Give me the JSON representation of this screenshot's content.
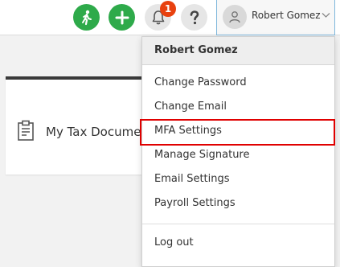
{
  "topbar": {
    "notification_count": "1"
  },
  "user": {
    "name": "Robert Gomez"
  },
  "card": {
    "title": "My Tax Docume"
  },
  "dropdown": {
    "header": "Robert Gomez",
    "items": [
      {
        "label": "Change Password"
      },
      {
        "label": "Change Email"
      },
      {
        "label": "MFA Settings"
      },
      {
        "label": "Manage Signature"
      },
      {
        "label": "Email Settings"
      },
      {
        "label": "Payroll Settings"
      }
    ],
    "logout": "Log out"
  },
  "colors": {
    "accent_green": "#2eaa4a",
    "badge_red": "#e8410f",
    "highlight_red": "#e00000"
  }
}
